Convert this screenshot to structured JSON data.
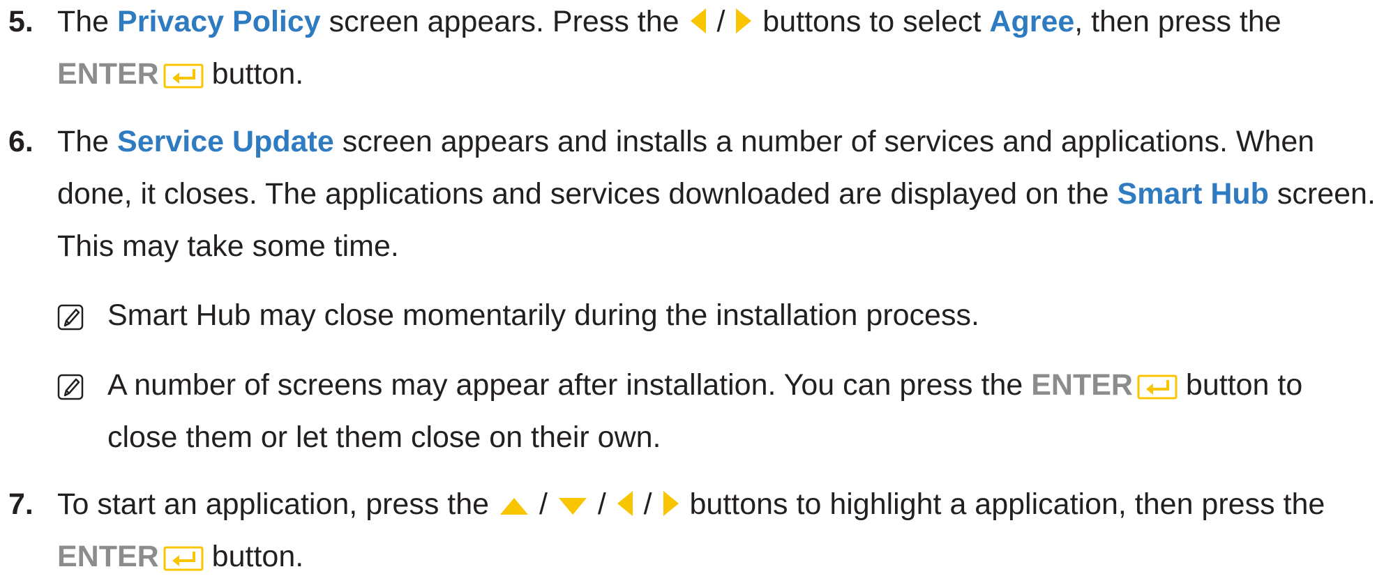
{
  "colors": {
    "highlight": "#2f7bc1",
    "enter_text": "#8c8c8c",
    "button_yellow": "#f9c400",
    "body_text": "#231f20"
  },
  "icons": {
    "left": "left-arrow-icon",
    "right": "right-arrow-icon",
    "up": "up-arrow-icon",
    "down": "down-arrow-icon",
    "enter": "enter-key-icon",
    "note": "note-pencil-icon"
  },
  "steps": [
    {
      "number": "5.",
      "t1": "The ",
      "h1": "Privacy Policy",
      "t2": " screen appears. Press the ",
      "slash": " / ",
      "t3": " buttons to select ",
      "h2": "Agree",
      "t4": ", then press the ",
      "enter": "ENTER",
      "t5": " button."
    },
    {
      "number": "6.",
      "t1": "The ",
      "h1": "Service Update",
      "t2": " screen appears and installs a number of services and applications. When done, it closes. The applications and services downloaded are displayed on the ",
      "h2": "Smart Hub",
      "t3": " screen. This may take some time."
    },
    {
      "number": "7.",
      "t1": "To start an application, press the ",
      "slash": " / ",
      "t2": " buttons to highlight a application, then press the ",
      "enter": "ENTER",
      "t3": " button."
    }
  ],
  "notes": [
    {
      "text": "Smart Hub may close momentarily during the installation process."
    },
    {
      "t1": "A number of screens may appear after installation. You can press the ",
      "enter": "ENTER",
      "t2": " button to close them or let them close on their own."
    }
  ]
}
